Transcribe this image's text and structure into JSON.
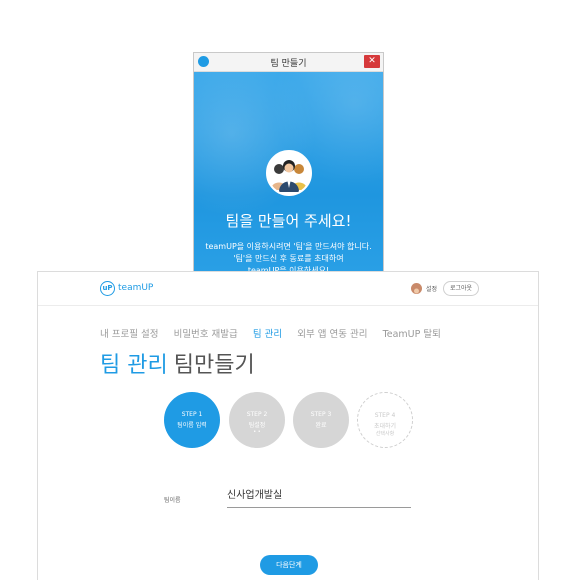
{
  "popup": {
    "title": "팀 만들기",
    "close_label": "✕",
    "heading": "팀을 만들어 주세요!",
    "description_lines": [
      "teamUP을 이용하시려면 '팀'을 만드셔야 합니다.",
      "'팀'을 만드신 후 동료를 초대하여",
      "teamUP을 이용하세요!"
    ]
  },
  "header": {
    "logo_text": "teamUP",
    "logo_glyph": "uP",
    "user_name": "설정",
    "logout_label": "로그아웃"
  },
  "nav": {
    "items": [
      {
        "label": "내 프로필 설정",
        "active": false
      },
      {
        "label": "비밀번호 재발급",
        "active": false
      },
      {
        "label": "팀 관리",
        "active": true
      },
      {
        "label": "외부 앱 연동 관리",
        "active": false
      },
      {
        "label": "TeamUP 탈퇴",
        "active": false
      }
    ]
  },
  "page": {
    "title_primary": "팀 관리",
    "title_secondary": "팀만들기"
  },
  "steps": [
    {
      "num": "STEP 1",
      "label": "팀이름 입력",
      "sub": "",
      "state": "active"
    },
    {
      "num": "STEP 2",
      "label": "팀설정",
      "sub": "• •",
      "state": "inactive"
    },
    {
      "num": "STEP 3",
      "label": "완료",
      "sub": "",
      "state": "inactive"
    },
    {
      "num": "STEP 4",
      "label": "초대하기",
      "sub": "선택사항",
      "state": "dashed"
    }
  ],
  "form": {
    "team_name_label": "팀이름",
    "team_name_value": "신사업개발실"
  },
  "actions": {
    "next_label": "다음단계"
  },
  "colors": {
    "accent": "#1f9be4",
    "close_red": "#d6393b",
    "step_inactive": "#d6d6d6"
  }
}
